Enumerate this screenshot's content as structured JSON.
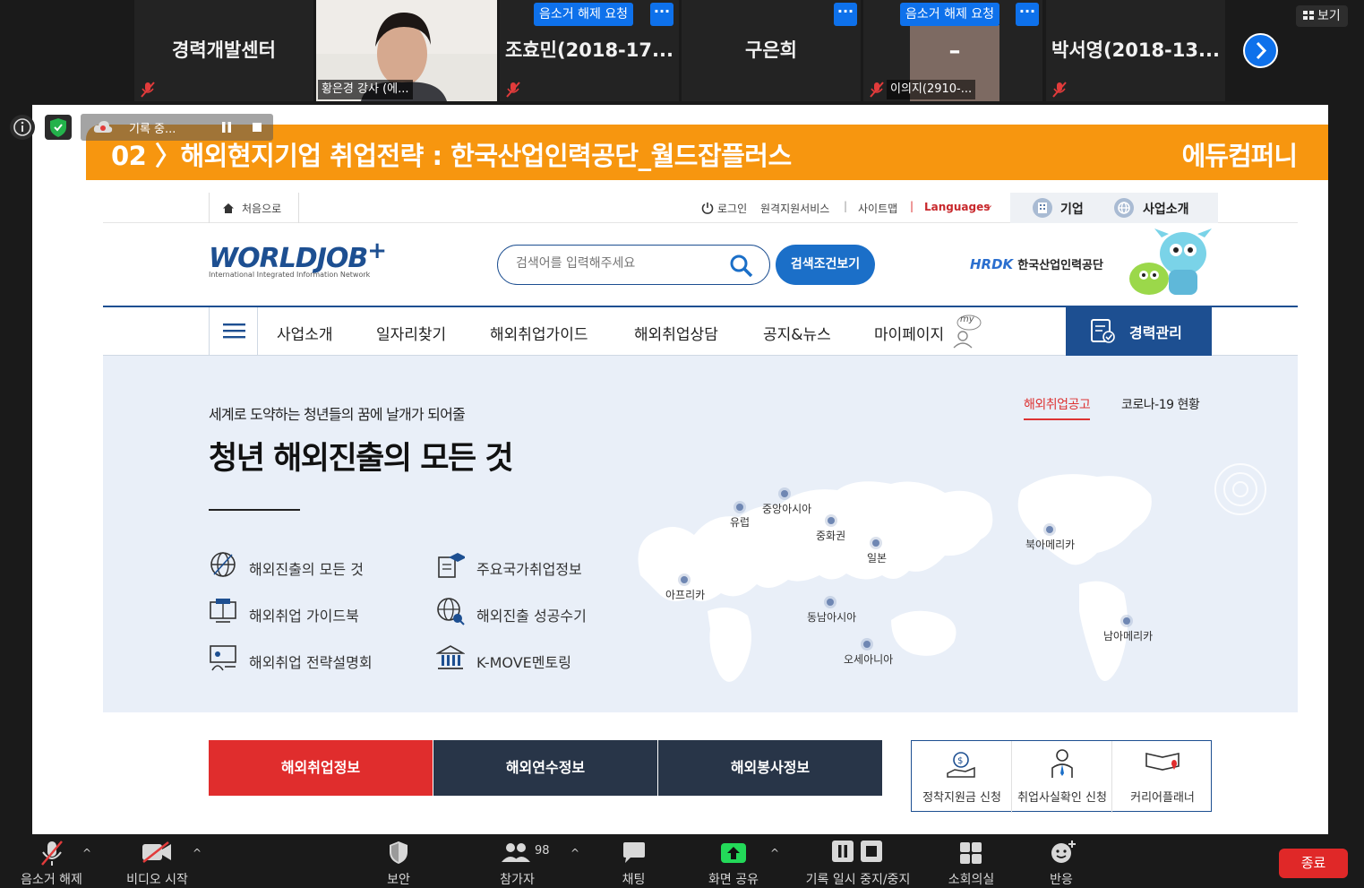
{
  "strip": {
    "tiles": [
      {
        "name": "경력개발센터"
      },
      {
        "name": "황은경 강사 (에..."
      },
      {
        "name": "조효민(2018-17..."
      },
      {
        "name": "구은희"
      },
      {
        "name": "이의지(2910-..."
      },
      {
        "name": "박서영(2018-13..."
      }
    ],
    "unmute_request": "음소거 해제 요청",
    "dots": "···",
    "video_dash": "–",
    "view_label": "보기"
  },
  "recording": {
    "label": "기록 중..."
  },
  "slide": {
    "title": "02 〉해외현지기업 취업전략 : 한국산업인력공단_월드잡플러스",
    "brand": "에듀컴퍼니"
  },
  "site": {
    "util": {
      "home": "처음으로",
      "login": "로그인",
      "remote": "원격지원서비스",
      "sitemap": "사이트맵",
      "languages": "Languages",
      "company": "기업",
      "business_intro": "사업소개",
      "sep": "|"
    },
    "logo": {
      "main": "WORLDJOB",
      "plus": "+",
      "sub": "International Integrated Information Network"
    },
    "search": {
      "placeholder": "검색어를 입력해주세요",
      "adv_button": "검색조건보기"
    },
    "hrdk": {
      "mark": "HRDK",
      "name": "한국산업인력공단"
    },
    "gnb": [
      "사업소개",
      "일자리찾기",
      "해외취업가이드",
      "해외취업상담",
      "공지&뉴스",
      "마이페이지"
    ],
    "my_badge": "my",
    "career_button": "경력관리",
    "hero": {
      "subtitle": "세계로 도약하는 청년들의 꿈에 날개가 되어줄",
      "title": "청년 해외진출의 모든 것",
      "tab_active": "해외취업공고",
      "tab_covid": "코로나-19 현황",
      "links": [
        "해외진출의 모든 것",
        "주요국가취업정보",
        "해외취업 가이드북",
        "해외진출 성공수기",
        "해외취업 전략설명회",
        "K-MOVE멘토링"
      ],
      "regions": [
        "유럽",
        "중앙아시아",
        "중화권",
        "일본",
        "북아메리카",
        "아프리카",
        "동남아시아",
        "오세아니아",
        "남아메리카"
      ]
    },
    "info_tabs": [
      "해외취업정보",
      "해외연수정보",
      "해외봉사정보"
    ],
    "quick": [
      "정착지원금 신청",
      "취업사실확인 신청",
      "커리어플래너"
    ]
  },
  "toolbar": {
    "mute": "음소거 해제",
    "video": "비디오 시작",
    "security": "보안",
    "participants": "참가자",
    "participants_count": "98",
    "chat": "채팅",
    "share": "화면 공유",
    "record": "기록 일시 중지/중지",
    "breakout": "소회의실",
    "reaction": "반응",
    "end": "종료"
  },
  "colors": {
    "accent_blue": "#0e71eb",
    "banner_orange": "#f7960f",
    "site_navy": "#1d4f91",
    "tab_red": "#e02d2d",
    "tab_dark": "#283548",
    "end_red": "#e02828",
    "share_green": "#23d959"
  }
}
